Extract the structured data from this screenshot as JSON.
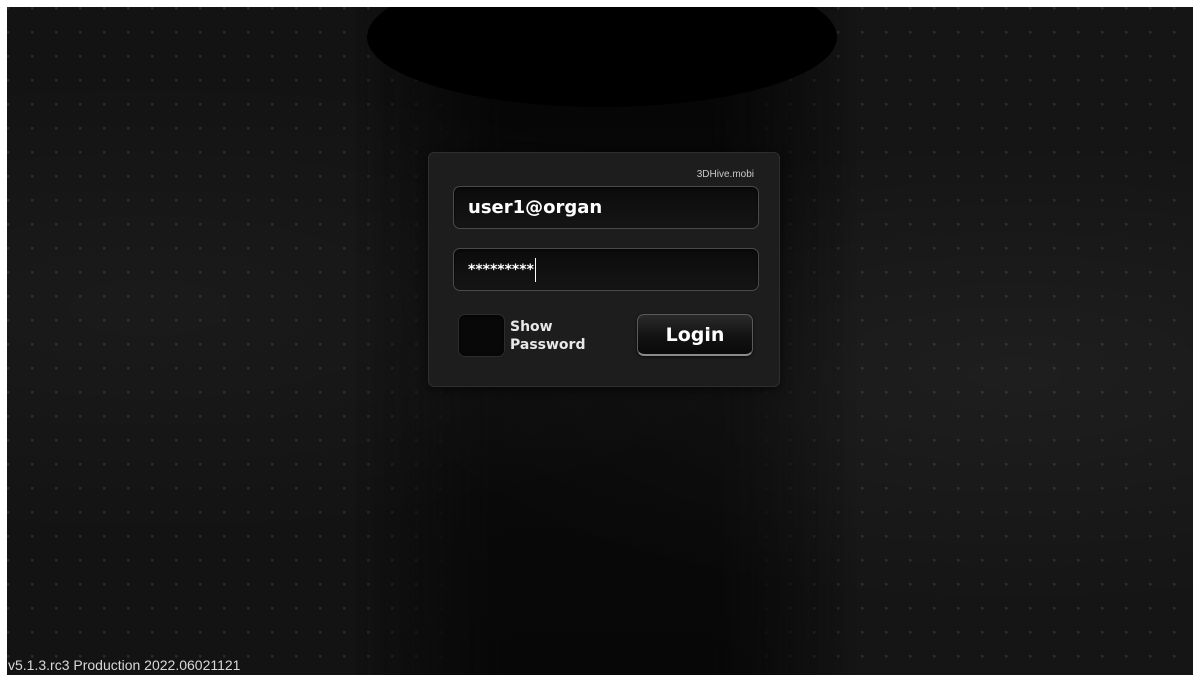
{
  "login_panel": {
    "brand": "3DHive.mobi",
    "username_value": "user1@organ",
    "password_value": "*********",
    "show_password_label": "Show\nPassword",
    "login_label": "Login"
  },
  "footer": {
    "version": "v5.1.3.rc3 Production 2022.06021121"
  },
  "colors": {
    "background": "#0d0d0d",
    "panel": "#1d1d1d",
    "text": "#ffffff"
  }
}
